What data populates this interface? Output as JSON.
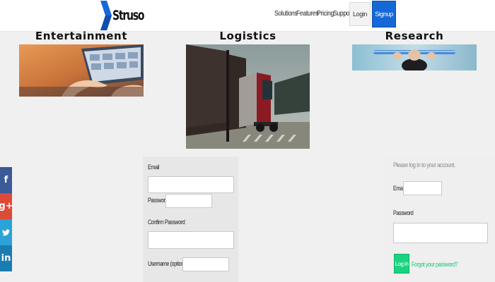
{
  "brand": {
    "name": "Struso",
    "accent": "#1668d8"
  },
  "nav": {
    "items": [
      "Solutions",
      "Features",
      "Pricing",
      "Support"
    ]
  },
  "header_buttons": {
    "login": "Login",
    "signup": "Signup"
  },
  "features": [
    {
      "title": "Entertainment",
      "image": "hands-on-tablet-photo"
    },
    {
      "title": "Logistics",
      "image": "red-cargo-truck-photo"
    },
    {
      "title": "Research",
      "image": "person-holding-tube-photo"
    }
  ],
  "social": [
    "f",
    "g+",
    "twitter-icon",
    "in"
  ],
  "signup_form": {
    "email_label": "Email",
    "password_label": "Password",
    "confirm_label": "Confirm Password",
    "username_label": "Username (optional)"
  },
  "login_form": {
    "heading": "Please log in to your account.",
    "email_label": "Email",
    "password_label": "Password",
    "button": "Log in",
    "forgot": "Forgot your password?"
  }
}
